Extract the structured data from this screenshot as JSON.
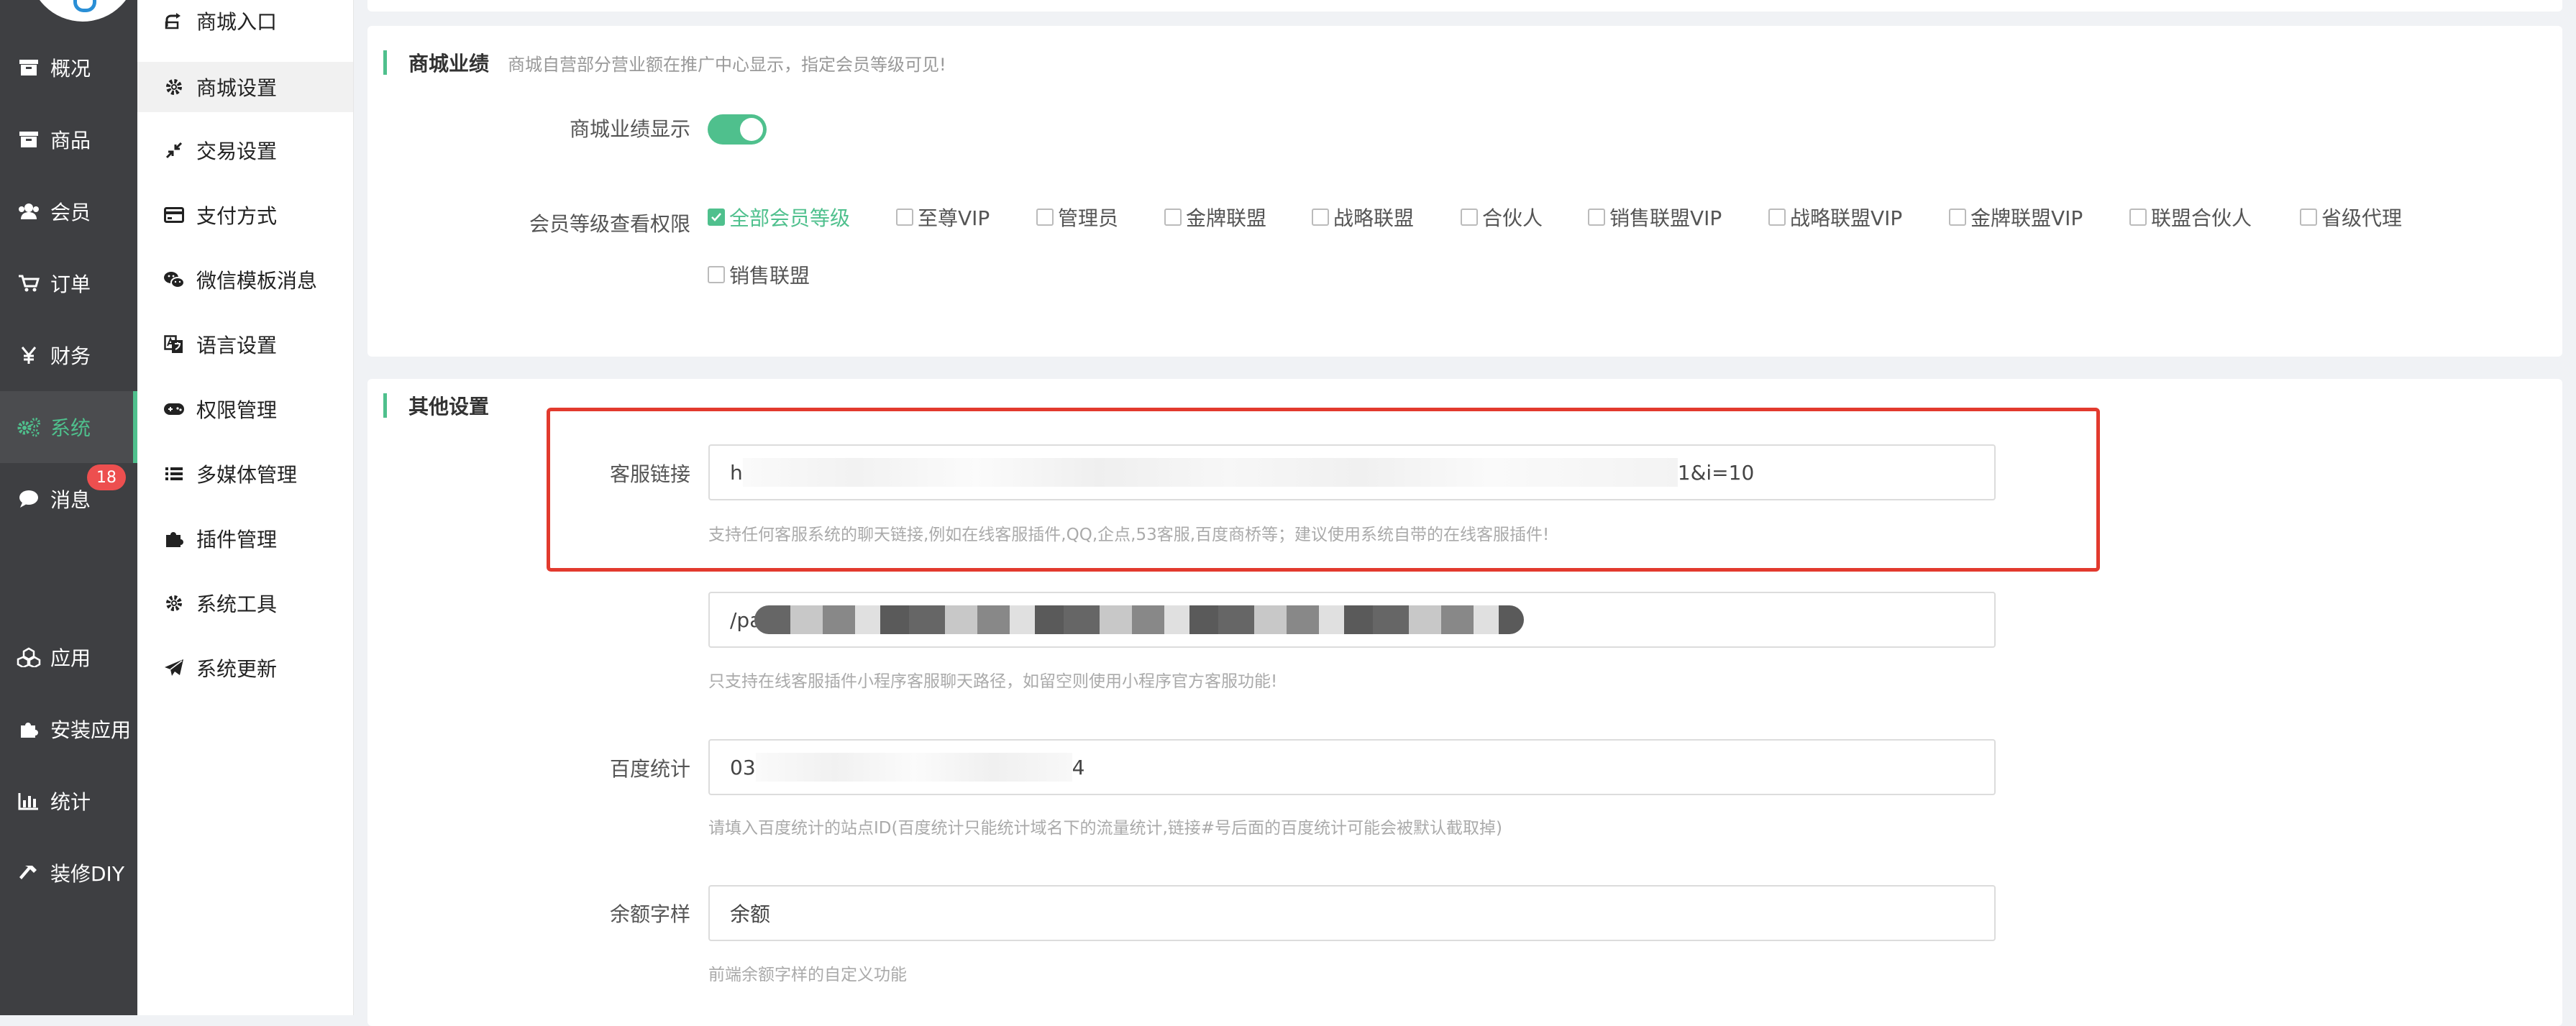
{
  "nav": {
    "items": [
      {
        "label": "概况",
        "icon": "archive-icon",
        "active": false
      },
      {
        "label": "商品",
        "icon": "box-icon",
        "active": false
      },
      {
        "label": "会员",
        "icon": "users-icon",
        "active": false
      },
      {
        "label": "订单",
        "icon": "cart-icon",
        "active": false
      },
      {
        "label": "财务",
        "icon": "yen-icon",
        "active": false
      },
      {
        "label": "系统",
        "icon": "gears-icon",
        "active": true
      },
      {
        "label": "消息",
        "icon": "chat-bubble-icon",
        "active": false
      },
      {
        "label": "应用",
        "icon": "cubes-icon",
        "active": false
      },
      {
        "label": "安装应用",
        "icon": "puzzle-icon",
        "active": false
      },
      {
        "label": "统计",
        "icon": "bar-chart-icon",
        "active": false
      },
      {
        "label": "装修DIY",
        "icon": "hammer-icon",
        "active": false
      }
    ],
    "messages_badge": "18",
    "accent": "#4fc08d"
  },
  "subnav": {
    "items": [
      {
        "label": "商城入口",
        "icon": "share-icon",
        "active": false
      },
      {
        "label": "商城设置",
        "icon": "gear-icon",
        "active": true
      },
      {
        "label": "交易设置",
        "icon": "compress-icon",
        "active": false
      },
      {
        "label": "支付方式",
        "icon": "credit-card-icon",
        "active": false
      },
      {
        "label": "微信模板消息",
        "icon": "wechat-icon",
        "active": false
      },
      {
        "label": "语言设置",
        "icon": "translate-icon",
        "active": false
      },
      {
        "label": "权限管理",
        "icon": "gamepad-icon",
        "active": false
      },
      {
        "label": "多媒体管理",
        "icon": "list-icon",
        "active": false
      },
      {
        "label": "插件管理",
        "icon": "puzzle-icon",
        "active": false
      },
      {
        "label": "系统工具",
        "icon": "gear-icon",
        "active": false
      },
      {
        "label": "系统更新",
        "icon": "paper-plane-icon",
        "active": false
      }
    ]
  },
  "performance": {
    "title": "商城业绩",
    "desc": "商城自营部分营业额在推广中心显示，指定会员等级可见!",
    "display_label": "商城业绩显示",
    "display_on": true,
    "levels_label": "会员等级查看权限",
    "levels": [
      {
        "label": "全部会员等级",
        "checked": true
      },
      {
        "label": "至尊VIP",
        "checked": false
      },
      {
        "label": "管理员",
        "checked": false
      },
      {
        "label": "金牌联盟",
        "checked": false
      },
      {
        "label": "战略联盟",
        "checked": false
      },
      {
        "label": "合伙人",
        "checked": false
      },
      {
        "label": "销售联盟VIP",
        "checked": false
      },
      {
        "label": "战略联盟VIP",
        "checked": false
      },
      {
        "label": "金牌联盟VIP",
        "checked": false
      },
      {
        "label": "联盟合伙人",
        "checked": false
      },
      {
        "label": "省级代理",
        "checked": false
      },
      {
        "label": "销售联盟",
        "checked": false
      }
    ]
  },
  "other": {
    "title": "其他设置",
    "service_link": {
      "label": "客服链接",
      "value_start": "h",
      "value_end": "1&i=10",
      "hint": "支持任何客服系统的聊天链接,例如在线客服插件,QQ,企点,53客服,百度商桥等；建议使用系统自带的在线客服插件!"
    },
    "mini_path": {
      "value_start": "/pa",
      "hint": "只支持在线客服插件小程序客服聊天路径，如留空则使用小程序官方客服功能!"
    },
    "baidu": {
      "label": "百度统计",
      "value_start": "03",
      "value_end": "4",
      "hint": "请填入百度统计的站点ID(百度统计只能统计域名下的流量统计,链接#号后面的百度统计可能会被默认截取掉)"
    },
    "balance": {
      "label": "余额字样",
      "value": "余额",
      "hint": "前端余额字样的自定义功能"
    }
  }
}
